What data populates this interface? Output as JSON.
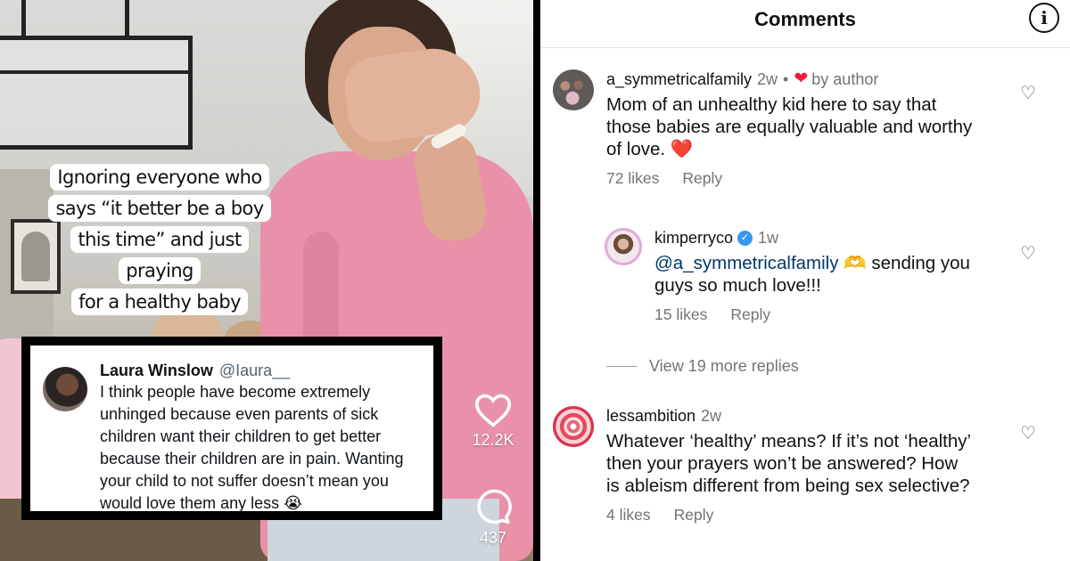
{
  "video": {
    "overlay_lines": [
      "Ignoring everyone who",
      "says “it better be a boy",
      "this time” and just praying",
      "for a healthy baby"
    ],
    "like_count": "12.2K",
    "comment_count": "437"
  },
  "tweet": {
    "name": "Laura Winslow",
    "handle": "@Iaura__",
    "text": "I think people have become extremely unhinged because even parents of sick children want their children to get better because their children are in pain. Wanting your child to not suffer doesn’t mean you would love them any less 😭"
  },
  "comments_panel": {
    "title": "Comments",
    "info_icon": "info-icon",
    "view_more": "View 19 more replies",
    "comments": [
      {
        "username": "a_symmetricalfamily",
        "time": "2w",
        "liked_by_author_label": "by author",
        "text": "Mom of an unhealthy kid here to say that those babies are equally valuable and worthy of love. ❤️",
        "likes": "72 likes",
        "reply": "Reply"
      },
      {
        "username": "kimperryco",
        "time": "1w",
        "mention": "@a_symmetricalfamily",
        "text": " 🫶 sending you guys so much love!!!",
        "likes": "15 likes",
        "reply": "Reply"
      },
      {
        "username": "lessambition",
        "time": "2w",
        "text": "Whatever ‘healthy’ means? If it’s not ‘healthy’ then your prayers won’t be answered? How is ableism different from being sex selective?",
        "likes": "4 likes",
        "reply": "Reply"
      }
    ]
  },
  "colors": {
    "accent_heart": "#ed1c3c",
    "verified": "#3897f0",
    "muted": "#737373",
    "mention": "#00376b"
  }
}
